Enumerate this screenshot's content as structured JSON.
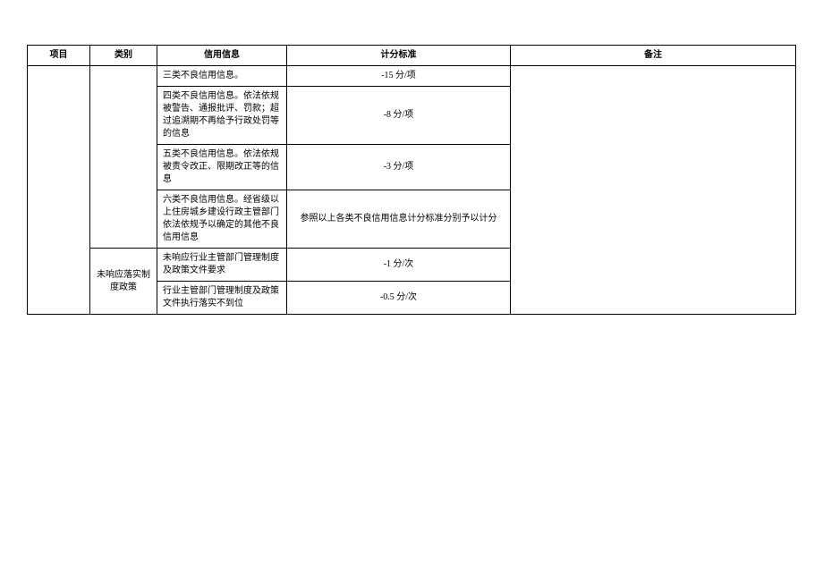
{
  "headers": {
    "project": "项目",
    "category": "类别",
    "info": "信用信息",
    "score": "计分标准",
    "remark": "备注"
  },
  "rows": [
    {
      "info": "三类不良信用信息。",
      "score": "-15 分/项"
    },
    {
      "info": "四类不良信用信息。依法依规被警告、通报批评、罚款；超过追溯期不再给予行政处罚等的信息",
      "score": "-8 分/项"
    },
    {
      "info": "五类不良信用信息。依法依规被责令改正、限期改正等的信息",
      "score": "-3 分/项"
    },
    {
      "info": "六类不良信用信息。经省级以上住房城乡建设行政主管部门依法依规予以确定的其他不良信用信息",
      "score": "参照以上各类不良信用信息计分标准分别予以计分"
    },
    {
      "info": "未响应行业主管部门管理制度及政策文件要求",
      "score": "-1 分/次"
    },
    {
      "info": "行业主管部门管理制度及政策文件执行落实不到位",
      "score": "-0.5 分/次"
    }
  ],
  "category2": "未响应落实制度政策"
}
